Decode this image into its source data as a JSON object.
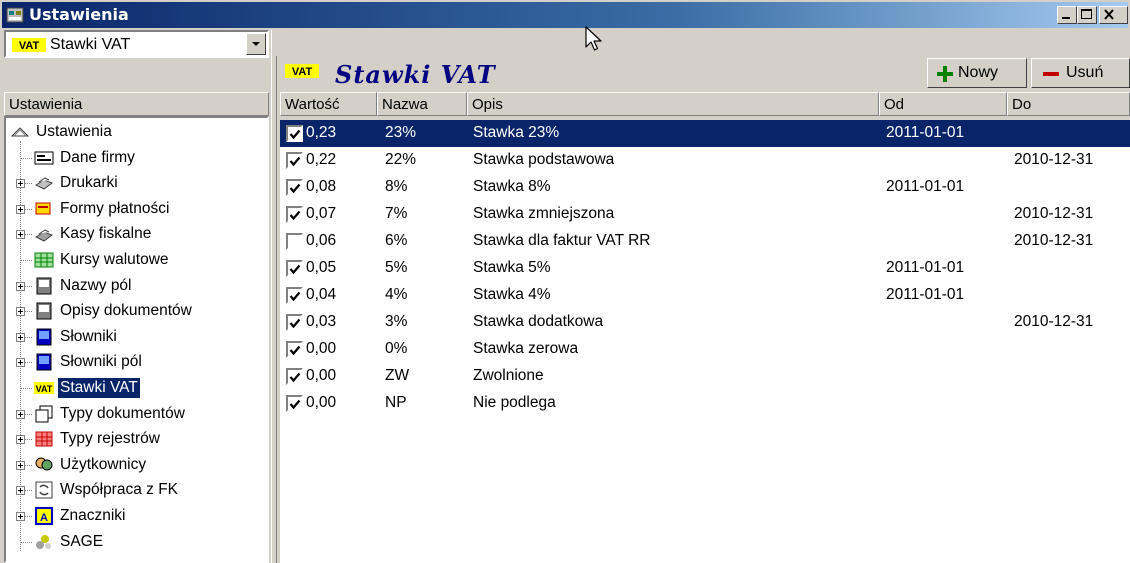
{
  "window": {
    "title": "Ustawienia",
    "controls": [
      "minimize-icon",
      "maximize-icon",
      "close-icon"
    ]
  },
  "left": {
    "combo": {
      "badge": "VAT",
      "value": "Stawki VAT"
    },
    "panel_header": "Ustawienia",
    "tree": [
      {
        "label": "Ustawienia",
        "icon": "root-icon",
        "level": 0,
        "expandable": false
      },
      {
        "label": "Dane firmy",
        "icon": "company-card-icon",
        "level": 1,
        "expandable": false
      },
      {
        "label": "Drukarki",
        "icon": "printer-icon",
        "level": 1,
        "expandable": true
      },
      {
        "label": "Formy płatności",
        "icon": "payment-icon",
        "level": 1,
        "expandable": true
      },
      {
        "label": "Kasy fiskalne",
        "icon": "cash-register-icon",
        "level": 1,
        "expandable": true
      },
      {
        "label": "Kursy walutowe",
        "icon": "currency-table-icon",
        "level": 1,
        "expandable": false
      },
      {
        "label": "Nazwy pól",
        "icon": "field-names-icon",
        "level": 1,
        "expandable": true
      },
      {
        "label": "Opisy dokumentów",
        "icon": "document-descriptions-icon",
        "level": 1,
        "expandable": true
      },
      {
        "label": "Słowniki",
        "icon": "dictionary-icon",
        "level": 1,
        "expandable": true
      },
      {
        "label": "Słowniki pól",
        "icon": "field-dictionary-icon",
        "level": 1,
        "expandable": true
      },
      {
        "label": "Stawki VAT",
        "icon": "vat-icon",
        "level": 1,
        "expandable": false,
        "selected": true
      },
      {
        "label": "Typy dokumentów",
        "icon": "document-types-icon",
        "level": 1,
        "expandable": true
      },
      {
        "label": "Typy rejestrów",
        "icon": "register-types-icon",
        "level": 1,
        "expandable": true
      },
      {
        "label": "Użytkownicy",
        "icon": "users-icon",
        "level": 1,
        "expandable": true
      },
      {
        "label": "Współpraca z FK",
        "icon": "fk-sync-icon",
        "level": 1,
        "expandable": true
      },
      {
        "label": "Znaczniki",
        "icon": "markers-icon",
        "level": 1,
        "expandable": true
      },
      {
        "label": "SAGE",
        "icon": "sage-icon",
        "level": 1,
        "expandable": false
      }
    ]
  },
  "right": {
    "badge": "VAT",
    "title": "Stawki VAT",
    "buttons": {
      "new": "Nowy",
      "delete": "Usuń"
    },
    "columns": [
      "Wartość",
      "Nazwa",
      "Opis",
      "Od",
      "Do"
    ],
    "rows": [
      {
        "checked": true,
        "value": "0,23",
        "name": "23%",
        "desc": "Stawka 23%",
        "from": "2011-01-01",
        "to": "",
        "selected": true
      },
      {
        "checked": true,
        "value": "0,22",
        "name": "22%",
        "desc": "Stawka podstawowa",
        "from": "",
        "to": "2010-12-31"
      },
      {
        "checked": true,
        "value": "0,08",
        "name": "8%",
        "desc": "Stawka 8%",
        "from": "2011-01-01",
        "to": ""
      },
      {
        "checked": true,
        "value": "0,07",
        "name": "7%",
        "desc": "Stawka zmniejszona",
        "from": "",
        "to": "2010-12-31"
      },
      {
        "checked": false,
        "value": "0,06",
        "name": "6%",
        "desc": "Stawka dla faktur VAT RR",
        "from": "",
        "to": "2010-12-31"
      },
      {
        "checked": true,
        "value": "0,05",
        "name": "5%",
        "desc": "Stawka 5%",
        "from": "2011-01-01",
        "to": ""
      },
      {
        "checked": true,
        "value": "0,04",
        "name": "4%",
        "desc": "Stawka 4%",
        "from": "2011-01-01",
        "to": ""
      },
      {
        "checked": true,
        "value": "0,03",
        "name": "3%",
        "desc": "Stawka dodatkowa",
        "from": "",
        "to": "2010-12-31"
      },
      {
        "checked": true,
        "value": "0,00",
        "name": "0%",
        "desc": "Stawka zerowa",
        "from": "",
        "to": ""
      },
      {
        "checked": true,
        "value": "0,00",
        "name": "ZW",
        "desc": "Zwolnione",
        "from": "",
        "to": ""
      },
      {
        "checked": true,
        "value": "0,00",
        "name": "NP",
        "desc": "Nie podlega",
        "from": "",
        "to": ""
      }
    ]
  },
  "colors": {
    "title_bar": "#0a246a",
    "selection": "#0a246a",
    "face": "#d4d0c8",
    "add": "#008000",
    "delete": "#c00000",
    "header_title": "#000080"
  }
}
